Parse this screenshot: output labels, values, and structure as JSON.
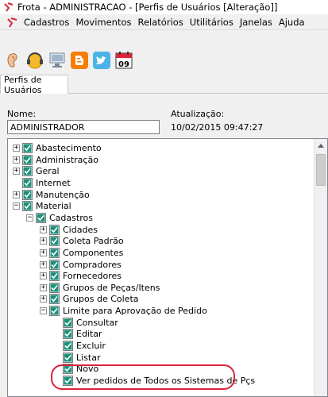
{
  "window": {
    "title": "Frota - ADMINISTRACAO - [Perfis de Usuários [Alteração]]"
  },
  "menu": {
    "items": [
      "Cadastros",
      "Movimentos",
      "Relatórios",
      "Utilitários",
      "Janelas",
      "Ajuda"
    ]
  },
  "toolbar": {
    "buttons": [
      {
        "icon": "ear-icon"
      },
      {
        "icon": "support-headset-icon"
      },
      {
        "icon": "computer-icon"
      },
      {
        "icon": "blogger-icon"
      },
      {
        "icon": "twitter-icon"
      },
      {
        "icon": "calendar-icon",
        "text": "09"
      }
    ]
  },
  "tabs": [
    {
      "label": "Perfis de Usuários",
      "active": true
    }
  ],
  "form": {
    "name_label": "Nome:",
    "name_value": "ADMINISTRADOR",
    "updated_label": "Atualização:",
    "updated_value": "10/02/2015 09:47:27"
  },
  "tree": {
    "nodes": [
      {
        "label": "Abastecimento",
        "level": 0,
        "expander": "+",
        "checked": true
      },
      {
        "label": "Administração",
        "level": 0,
        "expander": "+",
        "checked": true
      },
      {
        "label": "Geral",
        "level": 0,
        "expander": "+",
        "checked": true
      },
      {
        "label": "Internet",
        "level": 0,
        "expander": "",
        "checked": true
      },
      {
        "label": "Manutenção",
        "level": 0,
        "expander": "+",
        "checked": true
      },
      {
        "label": "Material",
        "level": 0,
        "expander": "-",
        "checked": true
      },
      {
        "label": "Cadastros",
        "level": 1,
        "expander": "-",
        "checked": true
      },
      {
        "label": "Cidades",
        "level": 2,
        "expander": "+",
        "checked": true
      },
      {
        "label": "Coleta Padrão",
        "level": 2,
        "expander": "+",
        "checked": true
      },
      {
        "label": "Componentes",
        "level": 2,
        "expander": "+",
        "checked": true
      },
      {
        "label": "Compradores",
        "level": 2,
        "expander": "+",
        "checked": true
      },
      {
        "label": "Fornecedores",
        "level": 2,
        "expander": "+",
        "checked": true
      },
      {
        "label": "Grupos de Peças/Itens",
        "level": 2,
        "expander": "+",
        "checked": true
      },
      {
        "label": "Grupos de Coleta",
        "level": 2,
        "expander": "+",
        "checked": true
      },
      {
        "label": "Limite para Aprovação de Pedido",
        "level": 2,
        "expander": "-",
        "checked": true
      },
      {
        "label": "Consultar",
        "level": 3,
        "expander": "",
        "checked": true
      },
      {
        "label": "Editar",
        "level": 3,
        "expander": "",
        "checked": true
      },
      {
        "label": "Excluir",
        "level": 3,
        "expander": "",
        "checked": true
      },
      {
        "label": "Listar",
        "level": 3,
        "expander": "",
        "checked": true
      },
      {
        "label": "Novo",
        "level": 3,
        "expander": "",
        "checked": true
      },
      {
        "label": "Ver pedidos de Todos os Sistemas de Pçs",
        "level": 3,
        "expander": "",
        "checked": true,
        "highlighted": true
      }
    ]
  },
  "colors": {
    "checkbox_fill": "#1d8f7a",
    "highlight_ring": "#d9243a",
    "title_bg": "#ffffff"
  }
}
